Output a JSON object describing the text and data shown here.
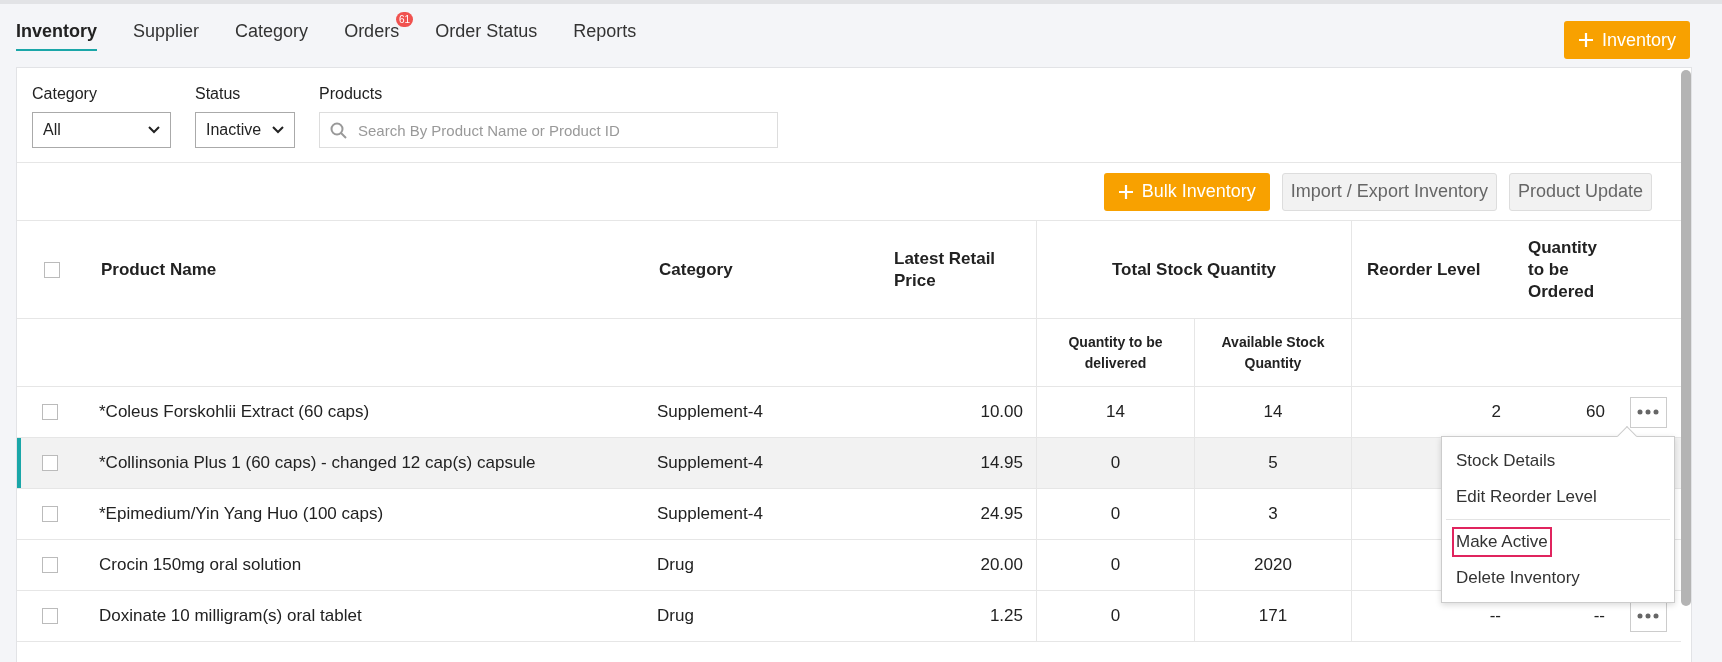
{
  "tabs": [
    {
      "label": "Inventory",
      "selected": true
    },
    {
      "label": "Supplier",
      "selected": false
    },
    {
      "label": "Category",
      "selected": false
    },
    {
      "label": "Orders",
      "selected": false,
      "badge": "61"
    },
    {
      "label": "Order Status",
      "selected": false
    },
    {
      "label": "Reports",
      "selected": false
    }
  ],
  "add_button": {
    "label": "Inventory"
  },
  "filters": {
    "category": {
      "label": "Category",
      "value": "All"
    },
    "status": {
      "label": "Status",
      "value": "Inactive"
    },
    "products": {
      "label": "Products",
      "placeholder": "Search By Product Name or Product ID"
    }
  },
  "toolbar": [
    {
      "label": "Bulk Inventory",
      "kind": "primary"
    },
    {
      "label": "Import / Export Inventory",
      "kind": "secondary"
    },
    {
      "label": "Product Update",
      "kind": "secondary"
    }
  ],
  "table": {
    "columns": {
      "product_name": "Product Name",
      "category": "Category",
      "price": "Latest Retail Price",
      "total_stock": "Total Stock Quantity",
      "to_deliver": "Quantity to be delivered",
      "available": "Available Stock Quantity",
      "reorder_level": "Reorder Level",
      "to_order": "Quantity to be Ordered"
    },
    "select_all_checked": false,
    "rows": [
      {
        "name": "*Coleus Forskohlii Extract (60 caps)",
        "category": "Supplement-4",
        "price": "10.00",
        "to_deliver": "14",
        "available": "14",
        "reorder_level": "2",
        "to_order": "60",
        "checked": false,
        "selected": false,
        "menu_open": true
      },
      {
        "name": "*Collinsonia Plus 1 (60 caps) - changed 12 cap(s) capsule",
        "category": "Supplement-4",
        "price": "14.95",
        "to_deliver": "0",
        "available": "5",
        "checked": false,
        "selected": true,
        "menu_open": false
      },
      {
        "name": "*Epimedium/Yin Yang Huo (100 caps)",
        "category": "Supplement-4",
        "price": "24.95",
        "to_deliver": "0",
        "available": "3",
        "checked": false,
        "selected": false,
        "menu_open": false
      },
      {
        "name": "Crocin 150mg oral solution",
        "category": "Drug",
        "price": "20.00",
        "to_deliver": "0",
        "available": "2020",
        "checked": false,
        "selected": false,
        "menu_open": false
      },
      {
        "name": "Doxinate 10 milligram(s) oral tablet",
        "category": "Drug",
        "price": "1.25",
        "to_deliver": "0",
        "available": "171",
        "reorder_level": "--",
        "to_order": "--",
        "checked": false,
        "selected": false,
        "menu_open": false
      }
    ]
  },
  "row_menu": {
    "groups": [
      [
        {
          "label": "Stock Details",
          "outlined": false
        },
        {
          "label": "Edit Reorder Level",
          "outlined": false
        }
      ],
      [
        {
          "label": "Make Active",
          "outlined": true
        },
        {
          "label": "Delete Inventory",
          "outlined": false
        }
      ]
    ]
  }
}
